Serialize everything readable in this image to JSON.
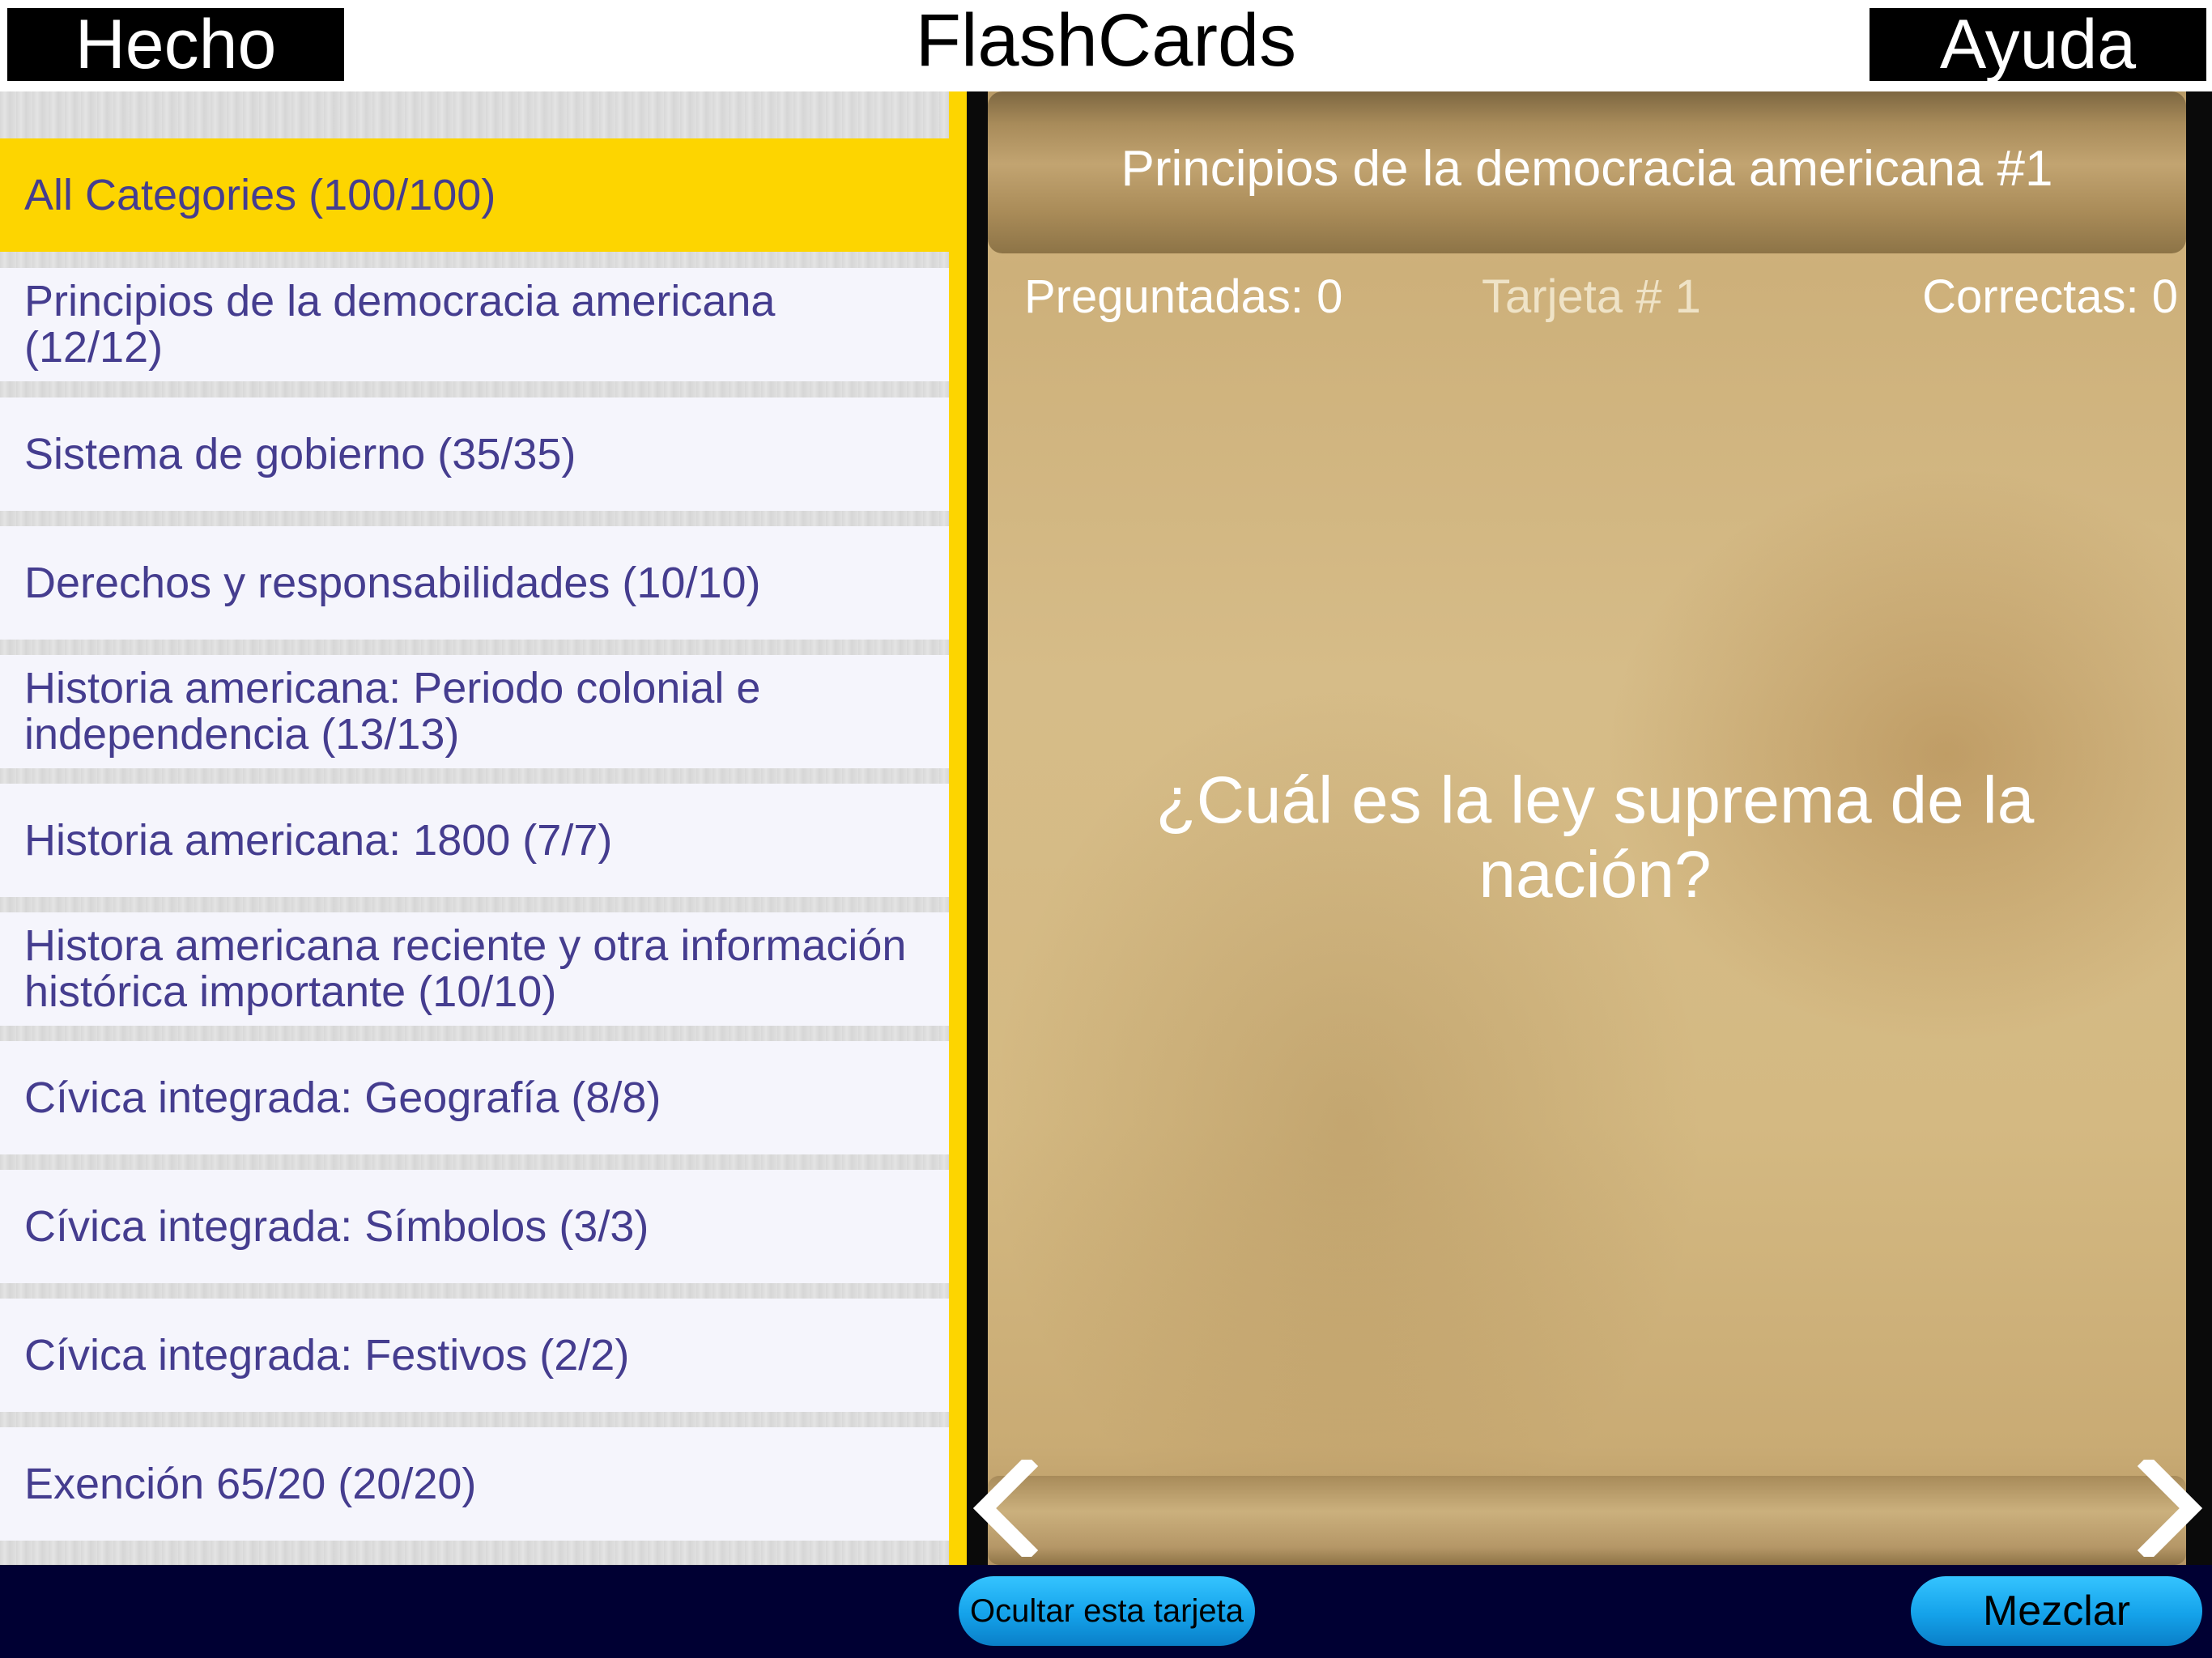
{
  "header": {
    "title": "FlashCards",
    "done_label": "Hecho",
    "help_label": "Ayuda"
  },
  "categories": [
    {
      "label": "All Categories (100/100)",
      "selected": true
    },
    {
      "label": "Principios de la democracia americana (12/12)",
      "selected": false
    },
    {
      "label": "Sistema de gobierno (35/35)",
      "selected": false
    },
    {
      "label": "Derechos y responsabilidades (10/10)",
      "selected": false
    },
    {
      "label": "Historia americana: Periodo colonial e independencia (13/13)",
      "selected": false
    },
    {
      "label": "Historia americana: 1800 (7/7)",
      "selected": false
    },
    {
      "label": "Histora americana reciente y otra información histórica importante (10/10)",
      "selected": false
    },
    {
      "label": "Cívica integrada: Geografía (8/8)",
      "selected": false
    },
    {
      "label": "Cívica integrada: Símbolos (3/3)",
      "selected": false
    },
    {
      "label": "Cívica integrada: Festivos (2/2)",
      "selected": false
    },
    {
      "label": "Exención 65/20 (20/20)",
      "selected": false
    }
  ],
  "card": {
    "header": "Principios de la democracia americana #1",
    "asked": "Preguntadas: 0",
    "card_number": "Tarjeta # 1",
    "correct": "Correctas: 0",
    "question": "¿Cuál es la ley suprema de la nación?"
  },
  "footer": {
    "hide_label": "Ocultar esta tarjeta",
    "shuffle_label": "Mezclar"
  },
  "colors": {
    "accent_yellow": "#fdd500",
    "category_text": "#453d8f",
    "bottom_bar": "#000033",
    "pill_button": "#14a2ea"
  },
  "icons": {
    "prev": "chevron-left-icon",
    "next": "chevron-right-icon"
  }
}
